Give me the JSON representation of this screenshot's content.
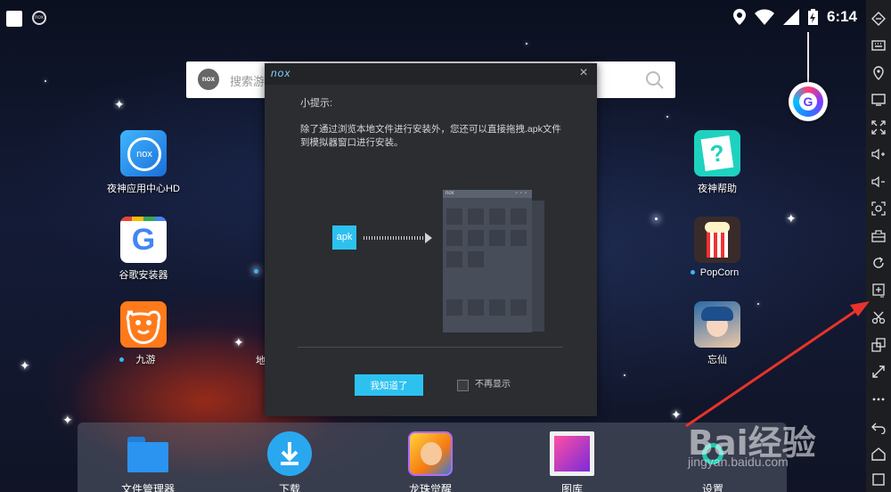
{
  "status_bar": {
    "time": "6:14"
  },
  "search": {
    "placeholder": "搜索游戏"
  },
  "desktop": {
    "left_apps": [
      {
        "label": "夜神应用中心HD",
        "logo_text": "nox"
      },
      {
        "label": "谷歌安装器",
        "logo_text": "G"
      },
      {
        "label": "九游"
      }
    ],
    "partial_label": "地",
    "right_apps": [
      {
        "label": "夜神帮助"
      },
      {
        "label": "PopCorn"
      },
      {
        "label": "忘仙"
      }
    ]
  },
  "dock": {
    "items": [
      {
        "label": "文件管理器"
      },
      {
        "label": "下载"
      },
      {
        "label": "龙珠觉醒"
      },
      {
        "label": "图库"
      },
      {
        "label": "设置"
      }
    ]
  },
  "dialog": {
    "logo": "nox",
    "close_glyph": "×",
    "tip_title": "小提示:",
    "tip_body": "除了通过浏览本地文件进行安装外，您还可以直接拖拽.apk文件到模拟器窗口进行安装。",
    "apk_label": "apk",
    "window_logo": "nox",
    "ok_button": "我知道了",
    "checkbox_label": "不再显示",
    "checkbox_checked": false
  },
  "floating_button": {
    "letter": "G"
  },
  "toolbar": {
    "icons": [
      "fullscreen-diamond-icon",
      "keyboard-icon",
      "location-icon",
      "screen-icon",
      "expand-icon",
      "volume-up-icon",
      "volume-down-icon",
      "screenshot-icon",
      "toolbox-icon",
      "rotate-icon",
      "install-apk-icon",
      "scissors-icon",
      "multi-window-icon",
      "resize-icon",
      "more-icon",
      "back-icon",
      "home-icon",
      "recent-apps-icon"
    ]
  },
  "watermark": {
    "brand": "Bai经验",
    "url": "jingyan.baidu.com"
  },
  "colors": {
    "accent": "#2dc1f0",
    "dialog_bg": "#2b2d31",
    "toolbar_bg": "#1d1e21",
    "annotation_arrow": "#e8332a"
  }
}
